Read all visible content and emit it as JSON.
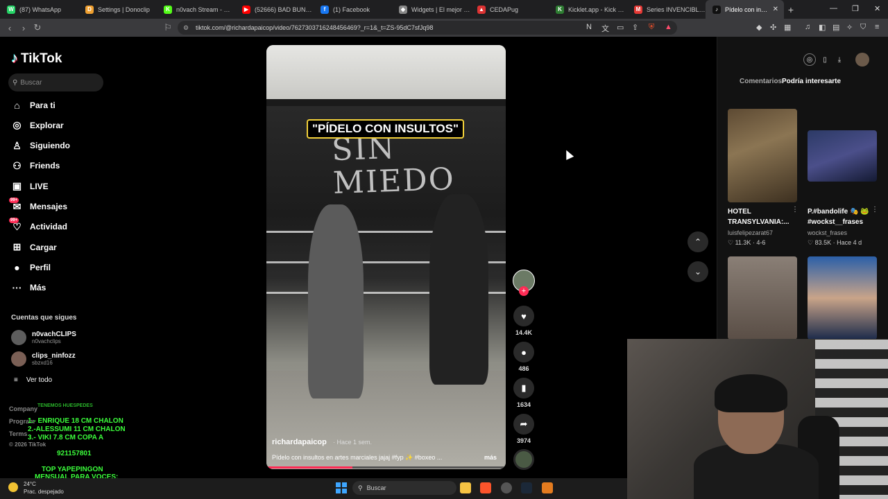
{
  "browser": {
    "tabs": [
      {
        "title": "(87) WhatsApp",
        "icon": "whatsapp-icon",
        "color": "#25d366",
        "glyph": "W"
      },
      {
        "title": "Settings | Donoclip",
        "icon": "donoclip-icon",
        "color": "#f0a030",
        "glyph": "D"
      },
      {
        "title": "n0vach Stream - Watch",
        "icon": "kick-icon",
        "color": "#53fc18",
        "glyph": "K"
      },
      {
        "title": "(52666) BAD BUNNY",
        "icon": "youtube-icon",
        "color": "#ff0000",
        "glyph": "▶"
      },
      {
        "title": "(1) Facebook",
        "icon": "facebook-icon",
        "color": "#1877f2",
        "glyph": "f"
      },
      {
        "title": "Widgets | El mejor software",
        "icon": "widgets-icon",
        "color": "#888888",
        "glyph": "◆"
      },
      {
        "title": "CEDAPug",
        "icon": "cedapug-icon",
        "color": "#d33",
        "glyph": "▲"
      },
      {
        "title": "Kicklet.app - Kick Chat",
        "icon": "kicklet-icon",
        "color": "#2e7d32",
        "glyph": "K"
      },
      {
        "title": "Series INVENCIBLE (2021)",
        "icon": "series-icon",
        "color": "#e53935",
        "glyph": "M"
      },
      {
        "title": "Pídelo con insultos",
        "icon": "tiktok-tab-icon",
        "color": "#111111",
        "glyph": "♪"
      }
    ],
    "new_tab": "+",
    "win_minimize": "—",
    "win_restore": "❐",
    "win_close": "✕",
    "url": "tiktok.com/@richardapaicop/video/7627303716248456469?_r=1&_t=ZS-95dC7sfJq98"
  },
  "tiktok": {
    "logo": "TikTok",
    "search_placeholder": "Buscar",
    "nav": [
      {
        "label": "Para ti",
        "icon": "home-icon",
        "glyph": "⌂"
      },
      {
        "label": "Explorar",
        "icon": "compass-icon",
        "glyph": "◎"
      },
      {
        "label": "Siguiendo",
        "icon": "following-icon",
        "glyph": "♙"
      },
      {
        "label": "Friends",
        "icon": "friends-icon",
        "glyph": "⚇"
      },
      {
        "label": "LIVE",
        "icon": "live-icon",
        "glyph": "▣"
      },
      {
        "label": "Mensajes",
        "icon": "messages-icon",
        "glyph": "✉",
        "badge": "99+"
      },
      {
        "label": "Actividad",
        "icon": "activity-icon",
        "glyph": "♡",
        "badge": "99+"
      },
      {
        "label": "Cargar",
        "icon": "upload-icon",
        "glyph": "⊞"
      },
      {
        "label": "Perfil",
        "icon": "profile-icon",
        "glyph": "●"
      },
      {
        "label": "Más",
        "icon": "more-icon",
        "glyph": "···"
      }
    ],
    "following_title": "Cuentas que sigues",
    "following": [
      {
        "name": "n0vachCLIPS",
        "handle": "n0vachclips"
      },
      {
        "name": "clips_ninfozz",
        "handle": "sbzxd16"
      }
    ],
    "see_all": "Ver todo",
    "footer": [
      "Company",
      "Program",
      "Terms",
      "© 2026 TikTok"
    ]
  },
  "overlay": {
    "line0": "TENEMOS HUESPEDES",
    "line1": "1.- ENRIQUE 18 CM CHALON",
    "line2": "2.-ALESSUMI 11 CM CHALON",
    "line3": "3.- VIKI 7.8 CM COPA A",
    "number": "921157801",
    "top1": "TOP YAPEPINGON",
    "top2": "MENSUAL PARA VOCES:"
  },
  "video": {
    "caption": "\"PÍDELO CON INSULTOS\"",
    "wall_text": "SIN\nMIEDO",
    "username": "richardapaicop",
    "time": "· Hace 1 sem.",
    "description": "Pídelo con insultos en artes marciales jajaj #fyp ✨ #boxeo ...",
    "more": "más",
    "progress": 0.36
  },
  "actions": {
    "likes": "14.4K",
    "comments": "486",
    "saves": "1634",
    "shares": "3974"
  },
  "rightpanel": {
    "tab_comments": "Comentarios",
    "tab_interest": "Podría interesarte",
    "recs": [
      {
        "title1": "HOTEL",
        "title2": "TRANSYLVANIA:...",
        "user": "luisfelipezarat67",
        "meta": "♡ 11.3K · 4-6"
      },
      {
        "title1": "P.#bandolife 🎭 🐸",
        "title2": "#wockst__frases",
        "user": "wockst_frases",
        "meta": "♡ 83.5K · Hace 4 d"
      }
    ]
  },
  "taskbar": {
    "temp": "24°C",
    "weather": "Prac. despejado",
    "search": "Buscar"
  }
}
